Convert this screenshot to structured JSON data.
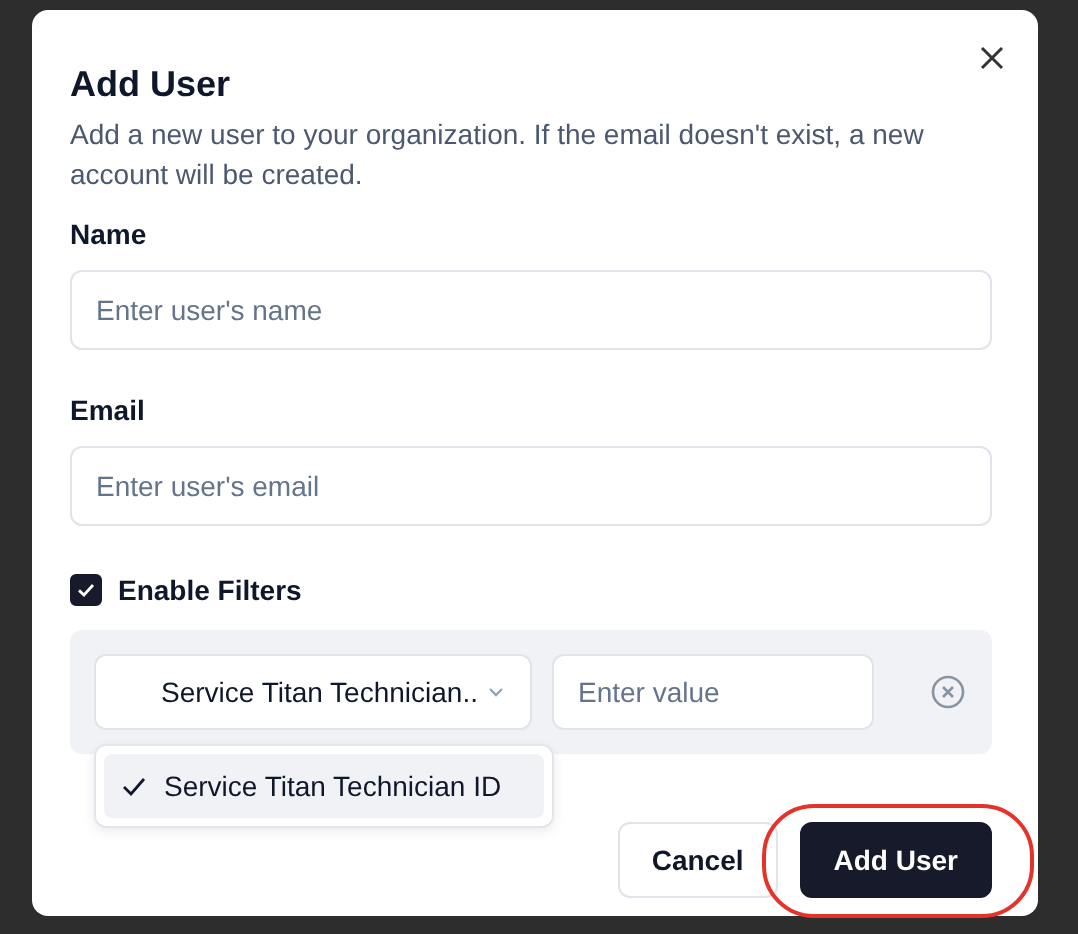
{
  "dialog": {
    "title": "Add User",
    "description": "Add a new user to your organization. If the email doesn't exist, a new account will be created."
  },
  "fields": [
    {
      "label": "Name",
      "placeholder": "Enter user's name"
    },
    {
      "label": "Email",
      "placeholder": "Enter user's email"
    }
  ],
  "enable_filters": {
    "label": "Enable Filters",
    "checked": true
  },
  "filter": {
    "selected_field": "Service Titan Technician..",
    "value_placeholder": "Enter value"
  },
  "dropdown": {
    "expanded": true,
    "options": [
      {
        "label": "Service Titan Technician ID",
        "selected": true
      }
    ]
  },
  "buttons": [
    {
      "label": "Cancel",
      "kind": "secondary",
      "highlighted": false
    },
    {
      "label": "Add User",
      "kind": "primary",
      "highlighted": true
    }
  ]
}
